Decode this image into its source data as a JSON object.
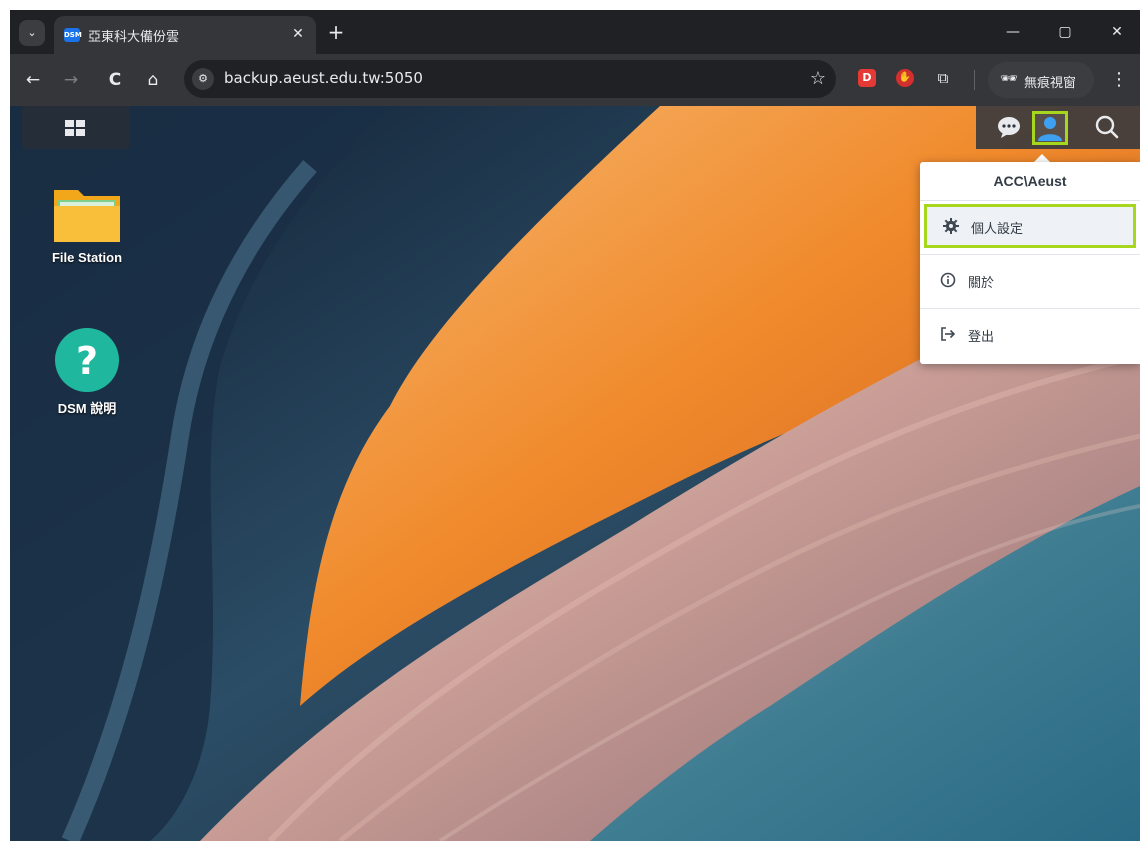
{
  "browser": {
    "tab": {
      "favicon_text": "DSM",
      "title": "亞東科大備份雲",
      "close_symbol": "✕"
    },
    "new_tab_symbol": "+",
    "window_controls": {
      "minimize": "—",
      "maximize": "▢",
      "close": "✕"
    },
    "toolbar": {
      "back": "←",
      "forward": "→",
      "reload": "C",
      "home": "⌂",
      "url": "backup.aeust.edu.tw:5050",
      "bookmark_star": "☆",
      "incognito_label": "無痕視窗",
      "menu": "⋮"
    },
    "extensions": [
      {
        "name": "ext-red-square",
        "color": "#e53935",
        "glyph": "D"
      },
      {
        "name": "ext-red-hand",
        "color": "#d32f2f",
        "glyph": "✋"
      },
      {
        "name": "extensions-puzzle",
        "color": "#35363a",
        "glyph": "⧉"
      }
    ]
  },
  "desktop": {
    "icons": [
      {
        "label": "File Station"
      },
      {
        "label": "DSM 說明"
      }
    ]
  },
  "user_menu": {
    "header": "ACC\\Aeust",
    "items": [
      {
        "label": "個人設定",
        "icon": "gear-icon"
      },
      {
        "label": "關於",
        "icon": "info-icon"
      },
      {
        "label": "登出",
        "icon": "logout-icon"
      }
    ]
  },
  "colors": {
    "highlight": "#a6d71c",
    "accent_blue": "#1a73e8",
    "chrome_dark": "#202124",
    "chrome_toolbar": "#35363a"
  }
}
